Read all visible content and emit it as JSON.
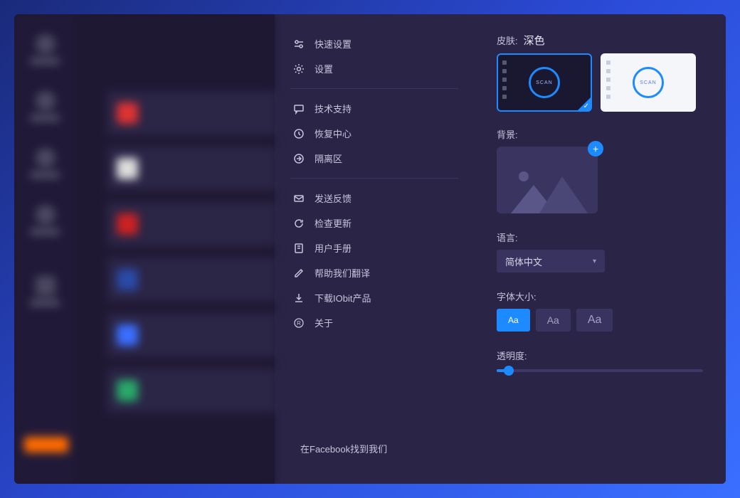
{
  "menu": {
    "quick_settings": "快速设置",
    "settings": "设置",
    "tech_support": "技术支持",
    "recovery_center": "恢复中心",
    "quarantine": "隔离区",
    "send_feedback": "发送反馈",
    "check_updates": "检查更新",
    "user_manual": "用户手册",
    "help_translate": "帮助我们翻译",
    "download_iobit": "下载IObit产品",
    "about": "关于"
  },
  "footer": {
    "facebook": "在Facebook找到我们"
  },
  "panel": {
    "skin_label": "皮肤:",
    "skin_value": "深色",
    "skin_scan_text": "SCAN",
    "background_label": "背景:",
    "language_label": "语言:",
    "language_value": "简体中文",
    "font_size_label": "字体大小:",
    "font_sample": "Aa",
    "opacity_label": "透明度:",
    "opacity_percent": 6
  }
}
